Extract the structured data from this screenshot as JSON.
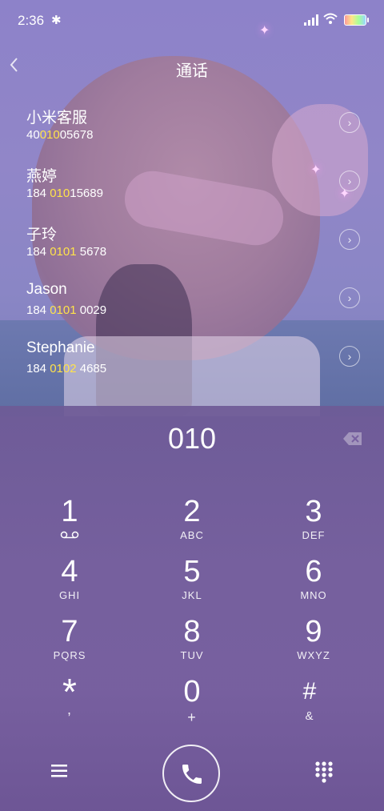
{
  "status": {
    "time": "2:36",
    "bluetooth_icon": "bluetooth-icon",
    "wifi_icon": "wifi-icon"
  },
  "header": {
    "back_icon": "chevron-left-icon",
    "title": "通话"
  },
  "contacts": [
    {
      "name": "小米客服",
      "num_pre": "40",
      "num_hl": "010",
      "num_post": "05678"
    },
    {
      "name": "燕婷",
      "num_pre": "184 ",
      "num_hl": "010",
      "num_post": "15689"
    },
    {
      "name": "子玲",
      "num_pre": "184 ",
      "num_hl": "0101",
      "num_post": " 5678"
    },
    {
      "name": "Jason",
      "num_pre": "184 ",
      "num_hl": "0101",
      "num_post": " 0029"
    },
    {
      "name": "Stephanie",
      "num_pre": "184 ",
      "num_hl": "0102",
      "num_post": " 4685"
    }
  ],
  "dialer": {
    "entered": "010",
    "keys": [
      {
        "d": "1",
        "l": ""
      },
      {
        "d": "2",
        "l": "ABC"
      },
      {
        "d": "3",
        "l": "DEF"
      },
      {
        "d": "4",
        "l": "GHI"
      },
      {
        "d": "5",
        "l": "JKL"
      },
      {
        "d": "6",
        "l": "MNO"
      },
      {
        "d": "7",
        "l": "PQRS"
      },
      {
        "d": "8",
        "l": "TUV"
      },
      {
        "d": "9",
        "l": "WXYZ"
      },
      {
        "d": "*",
        "l": ","
      },
      {
        "d": "0",
        "l": "+"
      },
      {
        "d": "#",
        "l": "&"
      }
    ]
  }
}
